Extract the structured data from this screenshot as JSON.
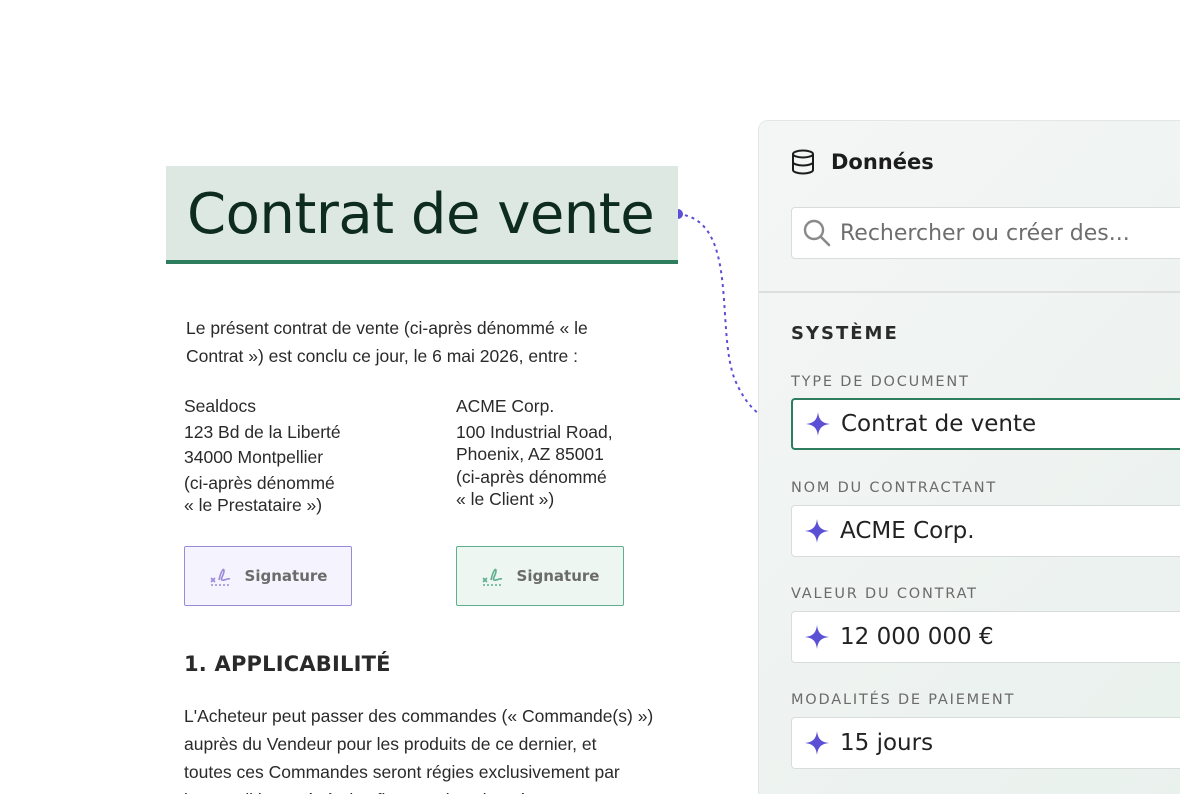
{
  "document": {
    "title": "Contrat de vente",
    "intro_line1": "Le présent contrat de vente (ci-après dénommé « le",
    "intro_line2": "Contrat ») est conclu ce jour, le 6 mai 2026, entre :",
    "party_left": {
      "name": "Sealdocs",
      "address1": "123 Bd de la Liberté",
      "address2": "34000 Montpellier",
      "role1": "(ci-après dénommé",
      "role2": "« le Prestataire »)"
    },
    "party_right": {
      "name": "ACME Corp.",
      "address1": "100 Industrial Road,",
      "address2": "Phoenix, AZ 85001",
      "role1": "(ci-après dénommé",
      "role2": "« le Client »)"
    },
    "signature_left": "Signature",
    "signature_right": "Signature",
    "section_heading": "1. APPLICABILITÉ",
    "section_lines": [
      "L'Acheteur peut passer des commandes (« Commande(s) »)",
      "auprès du Vendeur pour les produits de ce dernier, et",
      "toutes ces Commandes seront régies exclusivement par",
      "les conditions générales figurant dans le présent Contrat"
    ]
  },
  "panel": {
    "title": "Données",
    "search_placeholder": "Rechercher ou créer des...",
    "section": "SYSTÈME",
    "fields": [
      {
        "label": "TYPE DE DOCUMENT",
        "value": "Contrat de vente"
      },
      {
        "label": "NOM DU CONTRACTANT",
        "value": "ACME Corp."
      },
      {
        "label": "VALEUR DU CONTRAT",
        "value": "12 000 000 €"
      },
      {
        "label": "MODALITÉS DE PAIEMENT",
        "value": "15 jours"
      }
    ]
  },
  "colors": {
    "accent_green": "#2e7d5e",
    "accent_purple": "#5b4fd6",
    "title_highlight": "#dde8e3"
  },
  "icons": {
    "panel": "database-icon",
    "search": "search-icon",
    "field": "sparkle-icon",
    "signature": "signature-icon"
  }
}
